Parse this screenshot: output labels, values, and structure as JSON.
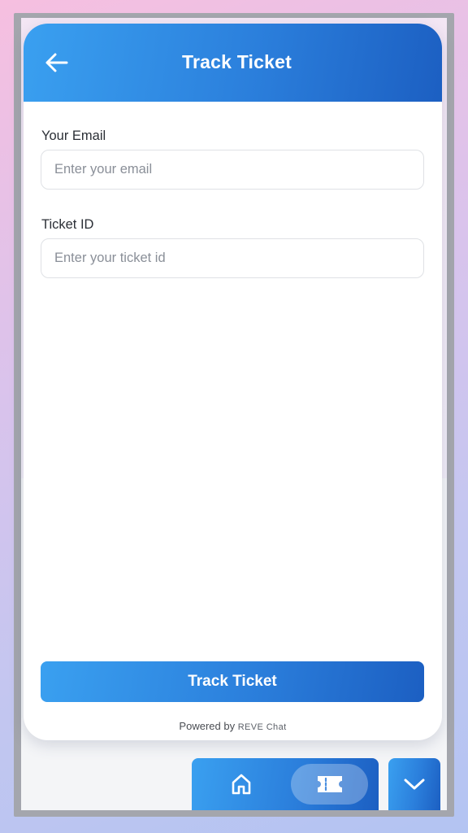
{
  "header": {
    "title": "Track Ticket",
    "back_icon": "arrow-left-icon"
  },
  "form": {
    "email": {
      "label": "Your Email",
      "placeholder": "Enter your email",
      "value": ""
    },
    "ticket_id": {
      "label": "Ticket ID",
      "placeholder": "Enter your ticket id",
      "value": ""
    },
    "submit_label": "Track Ticket"
  },
  "footer": {
    "powered_by": "Powered by",
    "brand": "REVE Chat"
  },
  "bottom_nav": {
    "items": [
      {
        "name": "home",
        "icon": "home-icon",
        "active": false
      },
      {
        "name": "ticket",
        "icon": "ticket-icon",
        "active": true
      }
    ],
    "collapse_icon": "chevron-down-icon"
  },
  "colors": {
    "accent_start": "#3aa0f0",
    "accent_end": "#1c5fc2",
    "background": "#ffffff"
  }
}
